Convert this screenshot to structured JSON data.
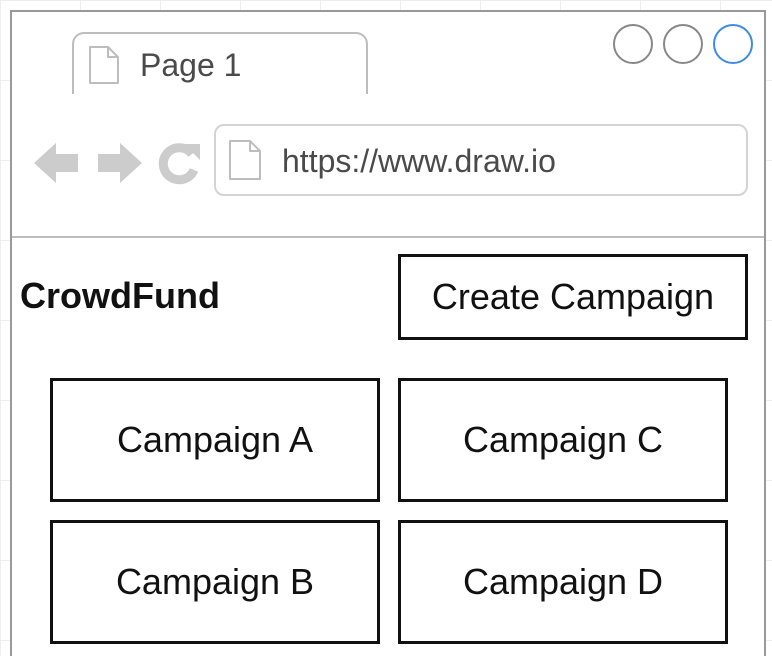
{
  "browser": {
    "tab": {
      "label": "Page 1",
      "icon": "document-icon"
    },
    "window_controls": [
      "minimize-circle",
      "maximize-circle",
      "close-circle"
    ],
    "window_controls_accent": "#3f8ae6",
    "nav": {
      "back_icon": "arrow-left-icon",
      "forward_icon": "arrow-right-icon",
      "reload_icon": "reload-icon"
    },
    "address_bar": {
      "value": "https://www.draw.io",
      "icon": "document-icon"
    }
  },
  "app": {
    "brand": "CrowdFund",
    "create_button_label": "Create Campaign",
    "campaigns": [
      {
        "label": "Campaign A"
      },
      {
        "label": "Campaign B"
      },
      {
        "label": "Campaign C"
      },
      {
        "label": "Campaign D"
      }
    ]
  },
  "colors": {
    "icon_gray": "#cccccc",
    "border_gray": "#bdbdbd",
    "text_dark": "#111111",
    "accent_blue": "#3f8ae6"
  }
}
